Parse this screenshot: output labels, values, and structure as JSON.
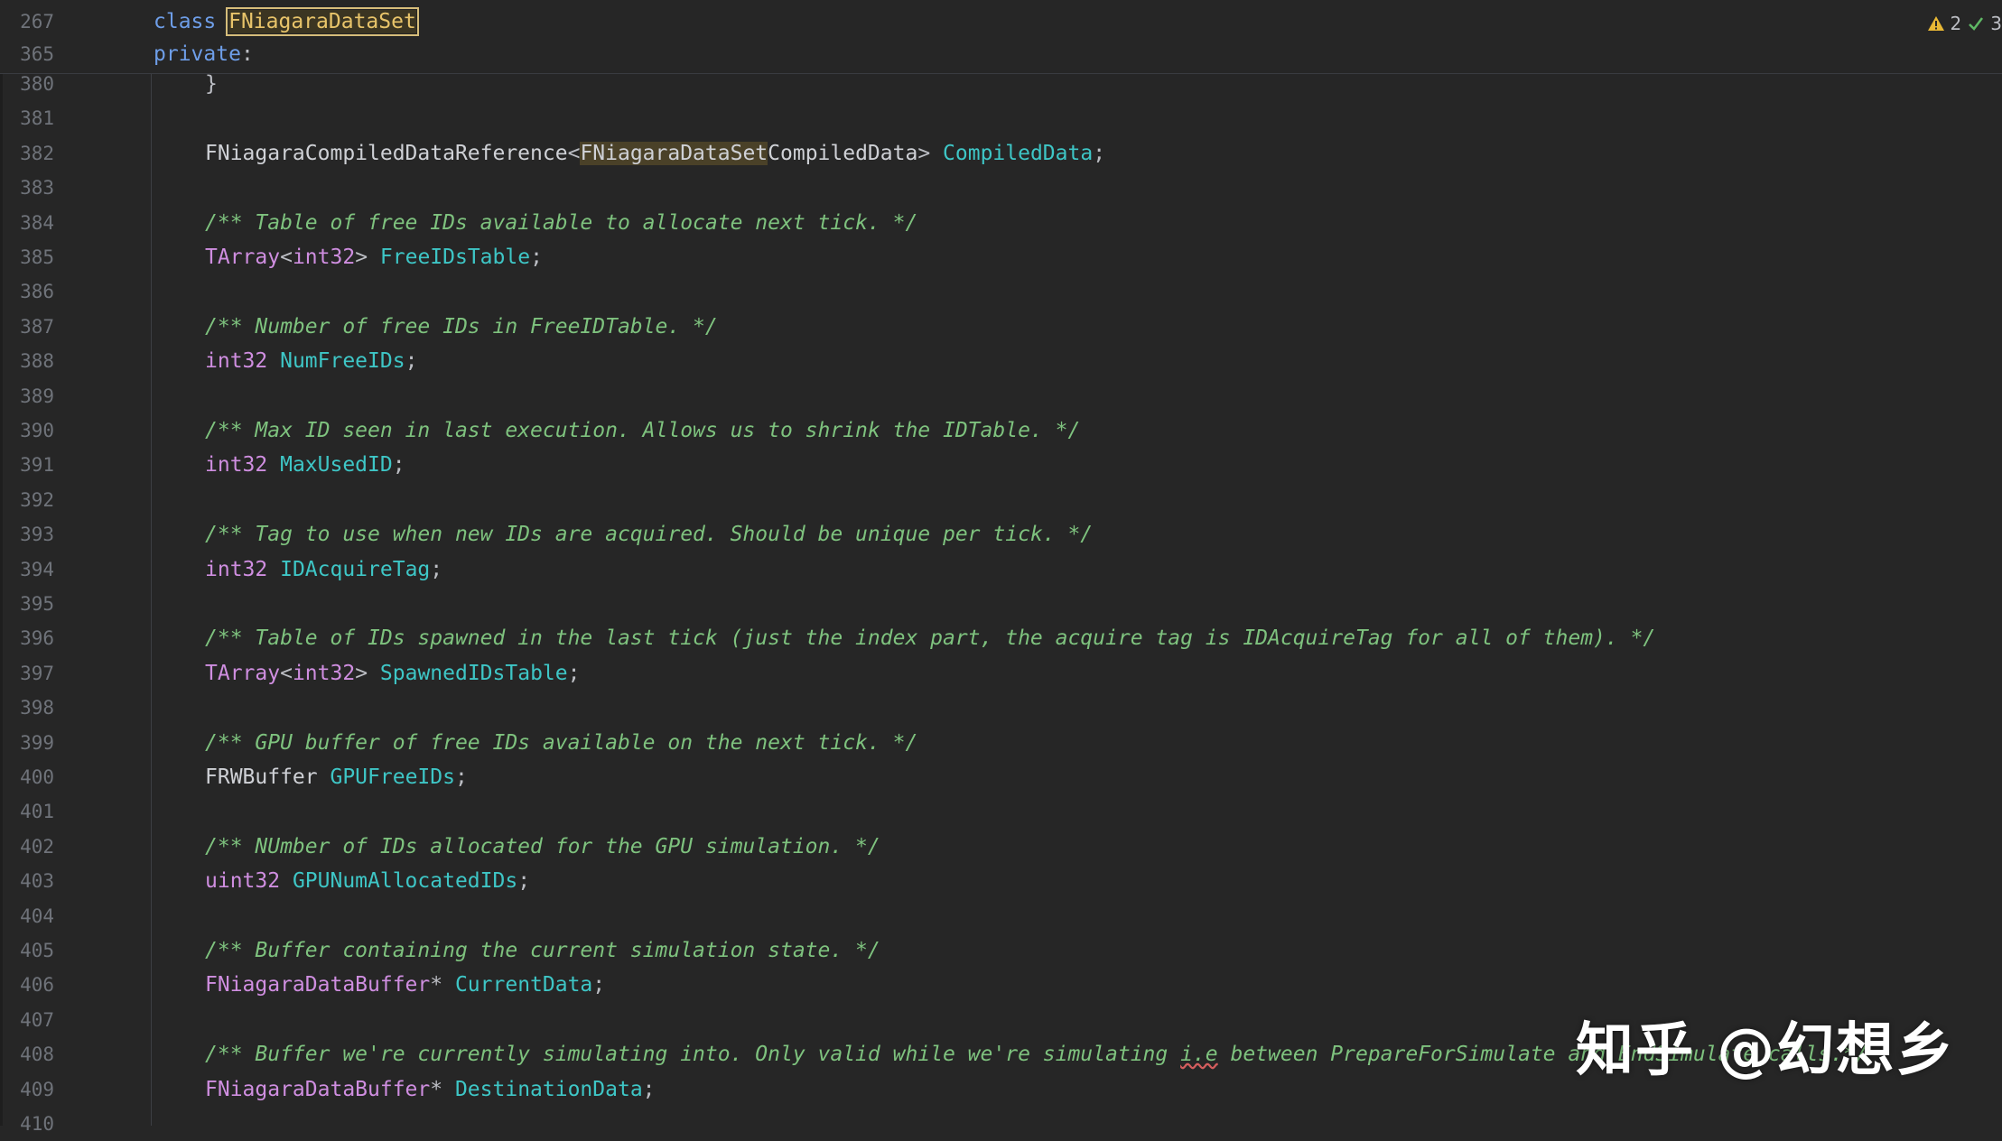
{
  "sticky_header": [
    {
      "line": "267",
      "tokens": [
        [
          "kw",
          "class "
        ],
        [
          "hlbox",
          "FNiagaraDataSet"
        ]
      ]
    },
    {
      "line": "365",
      "tokens": [
        [
          "kw",
          "private"
        ],
        [
          "punct",
          ":"
        ]
      ]
    }
  ],
  "inspections": {
    "warnings": "2",
    "ok": "3"
  },
  "lines": [
    {
      "n": "380",
      "indent": true,
      "tokens": [
        [
          "punct",
          "}"
        ]
      ]
    },
    {
      "n": "381",
      "indent": true,
      "tokens": []
    },
    {
      "n": "382",
      "indent": true,
      "tokens": [
        [
          "type",
          "FNiagaraCompiledDataReference"
        ],
        [
          "punct",
          "<"
        ],
        [
          "hlbg",
          "FNiagaraDataSet"
        ],
        [
          "type",
          "CompiledData"
        ],
        [
          "punct",
          "> "
        ],
        [
          "var",
          "CompiledData"
        ],
        [
          "punct",
          ";"
        ]
      ]
    },
    {
      "n": "383",
      "indent": true,
      "tokens": []
    },
    {
      "n": "384",
      "indent": true,
      "tokens": [
        [
          "cm",
          "/** Table of free IDs available to allocate next tick. */"
        ]
      ]
    },
    {
      "n": "385",
      "indent": true,
      "tokens": [
        [
          "tmpl",
          "TArray"
        ],
        [
          "punct",
          "<"
        ],
        [
          "kw2",
          "int32"
        ],
        [
          "punct",
          "> "
        ],
        [
          "var",
          "FreeIDsTable"
        ],
        [
          "punct",
          ";"
        ]
      ]
    },
    {
      "n": "386",
      "indent": true,
      "tokens": []
    },
    {
      "n": "387",
      "indent": true,
      "tokens": [
        [
          "cm",
          "/** Number of free IDs in FreeIDTable. */"
        ]
      ]
    },
    {
      "n": "388",
      "indent": true,
      "tokens": [
        [
          "kw2",
          "int32 "
        ],
        [
          "var",
          "NumFreeIDs"
        ],
        [
          "punct",
          ";"
        ]
      ]
    },
    {
      "n": "389",
      "indent": true,
      "tokens": []
    },
    {
      "n": "390",
      "indent": true,
      "tokens": [
        [
          "cm",
          "/** Max ID seen in last execution. Allows us to shrink the IDTable. */"
        ]
      ]
    },
    {
      "n": "391",
      "indent": true,
      "tokens": [
        [
          "kw2",
          "int32 "
        ],
        [
          "var",
          "MaxUsedID"
        ],
        [
          "punct",
          ";"
        ]
      ]
    },
    {
      "n": "392",
      "indent": true,
      "tokens": []
    },
    {
      "n": "393",
      "indent": true,
      "tokens": [
        [
          "cm",
          "/** Tag to use when new IDs are acquired. Should be unique per tick. */"
        ]
      ]
    },
    {
      "n": "394",
      "indent": true,
      "tokens": [
        [
          "kw2",
          "int32 "
        ],
        [
          "var",
          "IDAcquireTag"
        ],
        [
          "punct",
          ";"
        ]
      ]
    },
    {
      "n": "395",
      "indent": true,
      "tokens": []
    },
    {
      "n": "396",
      "indent": true,
      "tokens": [
        [
          "cm",
          "/** Table of IDs spawned in the last tick (just the index part, the acquire tag is IDAcquireTag for all of them). */"
        ]
      ]
    },
    {
      "n": "397",
      "indent": true,
      "tokens": [
        [
          "tmpl",
          "TArray"
        ],
        [
          "punct",
          "<"
        ],
        [
          "kw2",
          "int32"
        ],
        [
          "punct",
          "> "
        ],
        [
          "var",
          "SpawnedIDsTable"
        ],
        [
          "punct",
          ";"
        ]
      ]
    },
    {
      "n": "398",
      "indent": true,
      "tokens": []
    },
    {
      "n": "399",
      "indent": true,
      "tokens": [
        [
          "cm",
          "/** GPU buffer of free IDs available on the next tick. */"
        ]
      ]
    },
    {
      "n": "400",
      "indent": true,
      "tokens": [
        [
          "type",
          "FRWBuffer "
        ],
        [
          "var",
          "GPUFreeIDs"
        ],
        [
          "punct",
          ";"
        ]
      ]
    },
    {
      "n": "401",
      "indent": true,
      "tokens": []
    },
    {
      "n": "402",
      "indent": true,
      "tokens": [
        [
          "cm",
          "/** NUmber of IDs allocated for the GPU simulation. */"
        ]
      ]
    },
    {
      "n": "403",
      "indent": true,
      "tokens": [
        [
          "kw2",
          "uint32 "
        ],
        [
          "var",
          "GPUNumAllocatedIDs"
        ],
        [
          "punct",
          ";"
        ]
      ]
    },
    {
      "n": "404",
      "indent": true,
      "tokens": []
    },
    {
      "n": "405",
      "indent": true,
      "tokens": [
        [
          "cm",
          "/** Buffer containing the current simulation state. */"
        ]
      ]
    },
    {
      "n": "406",
      "indent": true,
      "tokens": [
        [
          "tmpl",
          "FNiagaraDataBuffer"
        ],
        [
          "punct",
          "* "
        ],
        [
          "var",
          "CurrentData"
        ],
        [
          "punct",
          ";"
        ]
      ]
    },
    {
      "n": "407",
      "indent": true,
      "tokens": []
    },
    {
      "n": "408",
      "indent": true,
      "tokens": [
        [
          "cm",
          "/** Buffer we're currently simulating into. Only valid while we're simulating "
        ],
        [
          "cmsq",
          "i.e"
        ],
        [
          "cm",
          " between PrepareForSimulate and EndSimulate calls.*/"
        ]
      ]
    },
    {
      "n": "409",
      "indent": true,
      "tokens": [
        [
          "tmpl",
          "FNiagaraDataBuffer"
        ],
        [
          "punct",
          "* "
        ],
        [
          "var",
          "DestinationData"
        ],
        [
          "punct",
          ";"
        ]
      ]
    },
    {
      "n": "410",
      "indent": true,
      "tokens": []
    }
  ],
  "watermark": "知乎 @幻想乡"
}
